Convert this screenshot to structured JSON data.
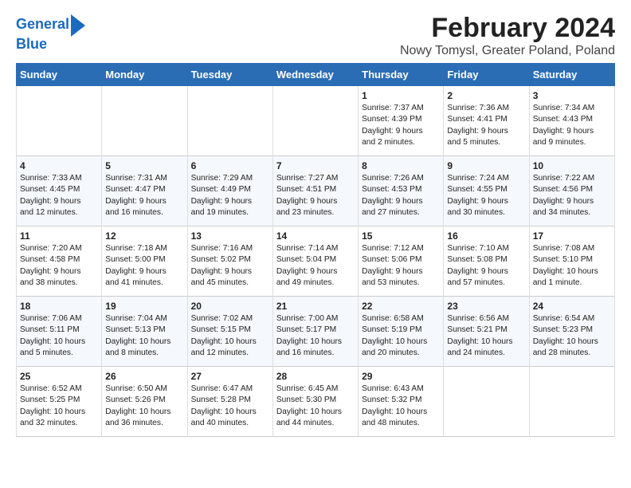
{
  "logo": {
    "line1": "General",
    "line2": "Blue"
  },
  "title": "February 2024",
  "subtitle": "Nowy Tomysl, Greater Poland, Poland",
  "days_of_week": [
    "Sunday",
    "Monday",
    "Tuesday",
    "Wednesday",
    "Thursday",
    "Friday",
    "Saturday"
  ],
  "weeks": [
    [
      {
        "day": "",
        "data": ""
      },
      {
        "day": "",
        "data": ""
      },
      {
        "day": "",
        "data": ""
      },
      {
        "day": "",
        "data": ""
      },
      {
        "day": "1",
        "data": "Sunrise: 7:37 AM\nSunset: 4:39 PM\nDaylight: 9 hours\nand 2 minutes."
      },
      {
        "day": "2",
        "data": "Sunrise: 7:36 AM\nSunset: 4:41 PM\nDaylight: 9 hours\nand 5 minutes."
      },
      {
        "day": "3",
        "data": "Sunrise: 7:34 AM\nSunset: 4:43 PM\nDaylight: 9 hours\nand 9 minutes."
      }
    ],
    [
      {
        "day": "4",
        "data": "Sunrise: 7:33 AM\nSunset: 4:45 PM\nDaylight: 9 hours\nand 12 minutes."
      },
      {
        "day": "5",
        "data": "Sunrise: 7:31 AM\nSunset: 4:47 PM\nDaylight: 9 hours\nand 16 minutes."
      },
      {
        "day": "6",
        "data": "Sunrise: 7:29 AM\nSunset: 4:49 PM\nDaylight: 9 hours\nand 19 minutes."
      },
      {
        "day": "7",
        "data": "Sunrise: 7:27 AM\nSunset: 4:51 PM\nDaylight: 9 hours\nand 23 minutes."
      },
      {
        "day": "8",
        "data": "Sunrise: 7:26 AM\nSunset: 4:53 PM\nDaylight: 9 hours\nand 27 minutes."
      },
      {
        "day": "9",
        "data": "Sunrise: 7:24 AM\nSunset: 4:55 PM\nDaylight: 9 hours\nand 30 minutes."
      },
      {
        "day": "10",
        "data": "Sunrise: 7:22 AM\nSunset: 4:56 PM\nDaylight: 9 hours\nand 34 minutes."
      }
    ],
    [
      {
        "day": "11",
        "data": "Sunrise: 7:20 AM\nSunset: 4:58 PM\nDaylight: 9 hours\nand 38 minutes."
      },
      {
        "day": "12",
        "data": "Sunrise: 7:18 AM\nSunset: 5:00 PM\nDaylight: 9 hours\nand 41 minutes."
      },
      {
        "day": "13",
        "data": "Sunrise: 7:16 AM\nSunset: 5:02 PM\nDaylight: 9 hours\nand 45 minutes."
      },
      {
        "day": "14",
        "data": "Sunrise: 7:14 AM\nSunset: 5:04 PM\nDaylight: 9 hours\nand 49 minutes."
      },
      {
        "day": "15",
        "data": "Sunrise: 7:12 AM\nSunset: 5:06 PM\nDaylight: 9 hours\nand 53 minutes."
      },
      {
        "day": "16",
        "data": "Sunrise: 7:10 AM\nSunset: 5:08 PM\nDaylight: 9 hours\nand 57 minutes."
      },
      {
        "day": "17",
        "data": "Sunrise: 7:08 AM\nSunset: 5:10 PM\nDaylight: 10 hours\nand 1 minute."
      }
    ],
    [
      {
        "day": "18",
        "data": "Sunrise: 7:06 AM\nSunset: 5:11 PM\nDaylight: 10 hours\nand 5 minutes."
      },
      {
        "day": "19",
        "data": "Sunrise: 7:04 AM\nSunset: 5:13 PM\nDaylight: 10 hours\nand 8 minutes."
      },
      {
        "day": "20",
        "data": "Sunrise: 7:02 AM\nSunset: 5:15 PM\nDaylight: 10 hours\nand 12 minutes."
      },
      {
        "day": "21",
        "data": "Sunrise: 7:00 AM\nSunset: 5:17 PM\nDaylight: 10 hours\nand 16 minutes."
      },
      {
        "day": "22",
        "data": "Sunrise: 6:58 AM\nSunset: 5:19 PM\nDaylight: 10 hours\nand 20 minutes."
      },
      {
        "day": "23",
        "data": "Sunrise: 6:56 AM\nSunset: 5:21 PM\nDaylight: 10 hours\nand 24 minutes."
      },
      {
        "day": "24",
        "data": "Sunrise: 6:54 AM\nSunset: 5:23 PM\nDaylight: 10 hours\nand 28 minutes."
      }
    ],
    [
      {
        "day": "25",
        "data": "Sunrise: 6:52 AM\nSunset: 5:25 PM\nDaylight: 10 hours\nand 32 minutes."
      },
      {
        "day": "26",
        "data": "Sunrise: 6:50 AM\nSunset: 5:26 PM\nDaylight: 10 hours\nand 36 minutes."
      },
      {
        "day": "27",
        "data": "Sunrise: 6:47 AM\nSunset: 5:28 PM\nDaylight: 10 hours\nand 40 minutes."
      },
      {
        "day": "28",
        "data": "Sunrise: 6:45 AM\nSunset: 5:30 PM\nDaylight: 10 hours\nand 44 minutes."
      },
      {
        "day": "29",
        "data": "Sunrise: 6:43 AM\nSunset: 5:32 PM\nDaylight: 10 hours\nand 48 minutes."
      },
      {
        "day": "",
        "data": ""
      },
      {
        "day": "",
        "data": ""
      }
    ]
  ]
}
